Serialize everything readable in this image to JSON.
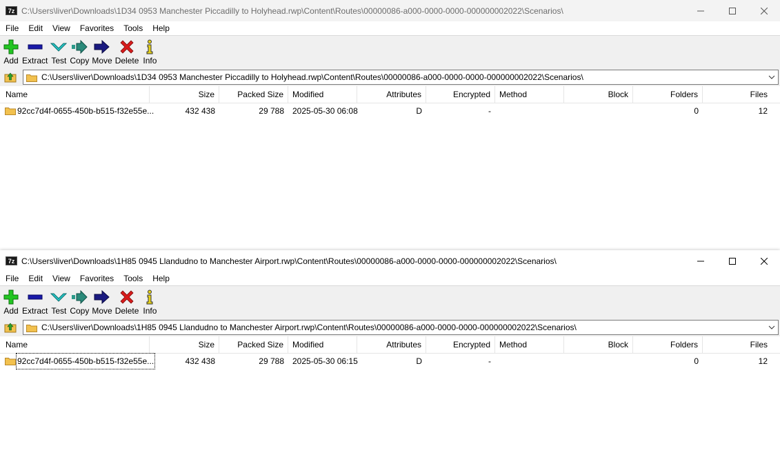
{
  "app_icon_text": "7z",
  "windows": [
    {
      "title": "C:\\Users\\liver\\Downloads\\1D34 0953 Manchester Piccadilly to Holyhead.rwp\\Content\\Routes\\00000086-a000-0000-0000-000000002022\\Scenarios\\",
      "address": "C:\\Users\\liver\\Downloads\\1D34 0953 Manchester Piccadilly to Holyhead.rwp\\Content\\Routes\\00000086-a000-0000-0000-000000002022\\Scenarios\\",
      "row": {
        "name": "92cc7d4f-0655-450b-b515-f32e55e...",
        "size": "432 438",
        "packed_size": "29 788",
        "modified": "2025-05-30 06:08",
        "attributes": "D",
        "encrypted": "-",
        "method": "",
        "block": "",
        "folders": "0",
        "files": "12"
      }
    },
    {
      "title": "C:\\Users\\liver\\Downloads\\1H85 0945 Llandudno to Manchester Airport.rwp\\Content\\Routes\\00000086-a000-0000-0000-000000002022\\Scenarios\\",
      "address": "C:\\Users\\liver\\Downloads\\1H85 0945 Llandudno to Manchester Airport.rwp\\Content\\Routes\\00000086-a000-0000-0000-000000002022\\Scenarios\\",
      "row": {
        "name": "92cc7d4f-0655-450b-b515-f32e55e...",
        "size": "432 438",
        "packed_size": "29 788",
        "modified": "2025-05-30 06:15",
        "attributes": "D",
        "encrypted": "-",
        "method": "",
        "block": "",
        "folders": "0",
        "files": "12"
      }
    }
  ],
  "menu": [
    "File",
    "Edit",
    "View",
    "Favorites",
    "Tools",
    "Help"
  ],
  "toolbar": {
    "add": "Add",
    "extract": "Extract",
    "test": "Test",
    "copy": "Copy",
    "move": "Move",
    "delete": "Delete",
    "info": "Info"
  },
  "columns": {
    "name": "Name",
    "size": "Size",
    "packed_size": "Packed Size",
    "modified": "Modified",
    "attributes": "Attributes",
    "encrypted": "Encrypted",
    "method": "Method",
    "block": "Block",
    "folders": "Folders",
    "files": "Files"
  },
  "icons": {
    "add": "plus-icon",
    "extract": "minus-icon",
    "test": "check-icon",
    "copy": "double-arrow-icon",
    "move": "arrow-right-icon",
    "delete": "x-icon",
    "info": "info-icon",
    "up": "folder-up-icon",
    "folder": "folder-icon"
  },
  "colors": {
    "add": "#22c522",
    "extract": "#1a1aa8",
    "test": "#28c8c8",
    "copy": "#2a9a8a",
    "move": "#1a1a80",
    "delete": "#d81c1c",
    "info": "#e6d21a",
    "folder": "#f2c14e"
  }
}
